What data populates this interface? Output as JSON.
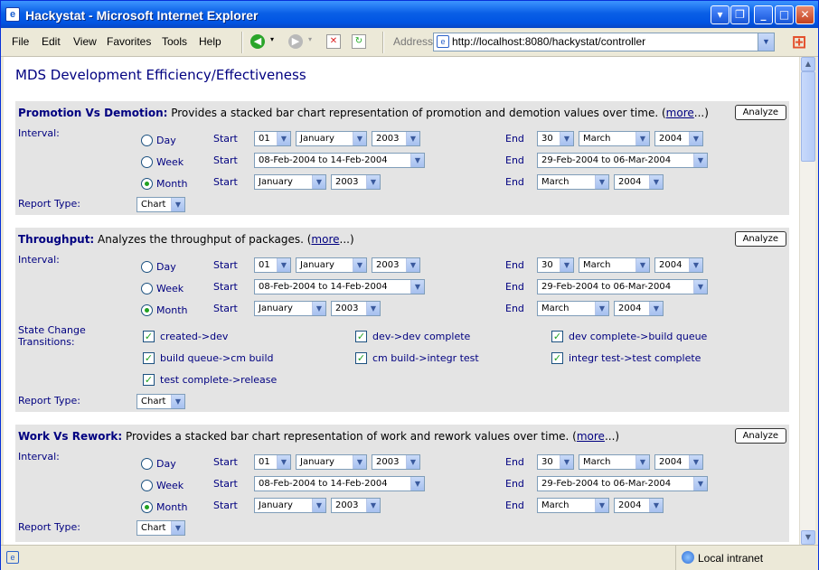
{
  "window": {
    "title": "Hackystat - Microsoft Internet Explorer"
  },
  "menu": [
    "File",
    "Edit",
    "View",
    "Favorites",
    "Tools",
    "Help"
  ],
  "address": {
    "label": "Address",
    "url": "http://localhost:8080/hackystat/controller"
  },
  "page": {
    "title": "MDS Development Efficiency/Effectiveness"
  },
  "common": {
    "interval": "Interval:",
    "report_type": "Report Type:",
    "report_value": "Chart",
    "analyze": "Analyze",
    "day": "Day",
    "week": "Week",
    "month": "Month",
    "start": "Start",
    "end": "End",
    "start_day": "01",
    "start_month": "January",
    "start_year": "2003",
    "end_day": "30",
    "end_month": "March",
    "end_year": "2004",
    "start_week": "08-Feb-2004 to 14-Feb-2004",
    "end_week": "29-Feb-2004 to 06-Mar-2004",
    "month_start_month": "January",
    "month_start_year": "2003",
    "month_end_month": "March",
    "month_end_year": "2004",
    "more_open": "(",
    "more_link": "more",
    "more_close": "...)"
  },
  "sections": [
    {
      "title": "Promotion Vs Demotion:",
      "desc": " Provides a stacked bar chart representation of promotion and demotion values over time. "
    },
    {
      "title": "Throughput:",
      "desc": " Analyzes the throughput of packages. ",
      "state_label_1": "State Change",
      "state_label_2": "Transitions:",
      "transitions": [
        "created->dev",
        "dev->dev complete",
        "dev complete->build queue",
        "build queue->cm build",
        "cm build->integr test",
        "integr test->test complete",
        "test complete->release"
      ]
    },
    {
      "title": "Work Vs Rework:",
      "desc": " Provides a stacked bar chart representation of work and rework values over time. "
    }
  ],
  "status": {
    "zone": "Local intranet"
  }
}
